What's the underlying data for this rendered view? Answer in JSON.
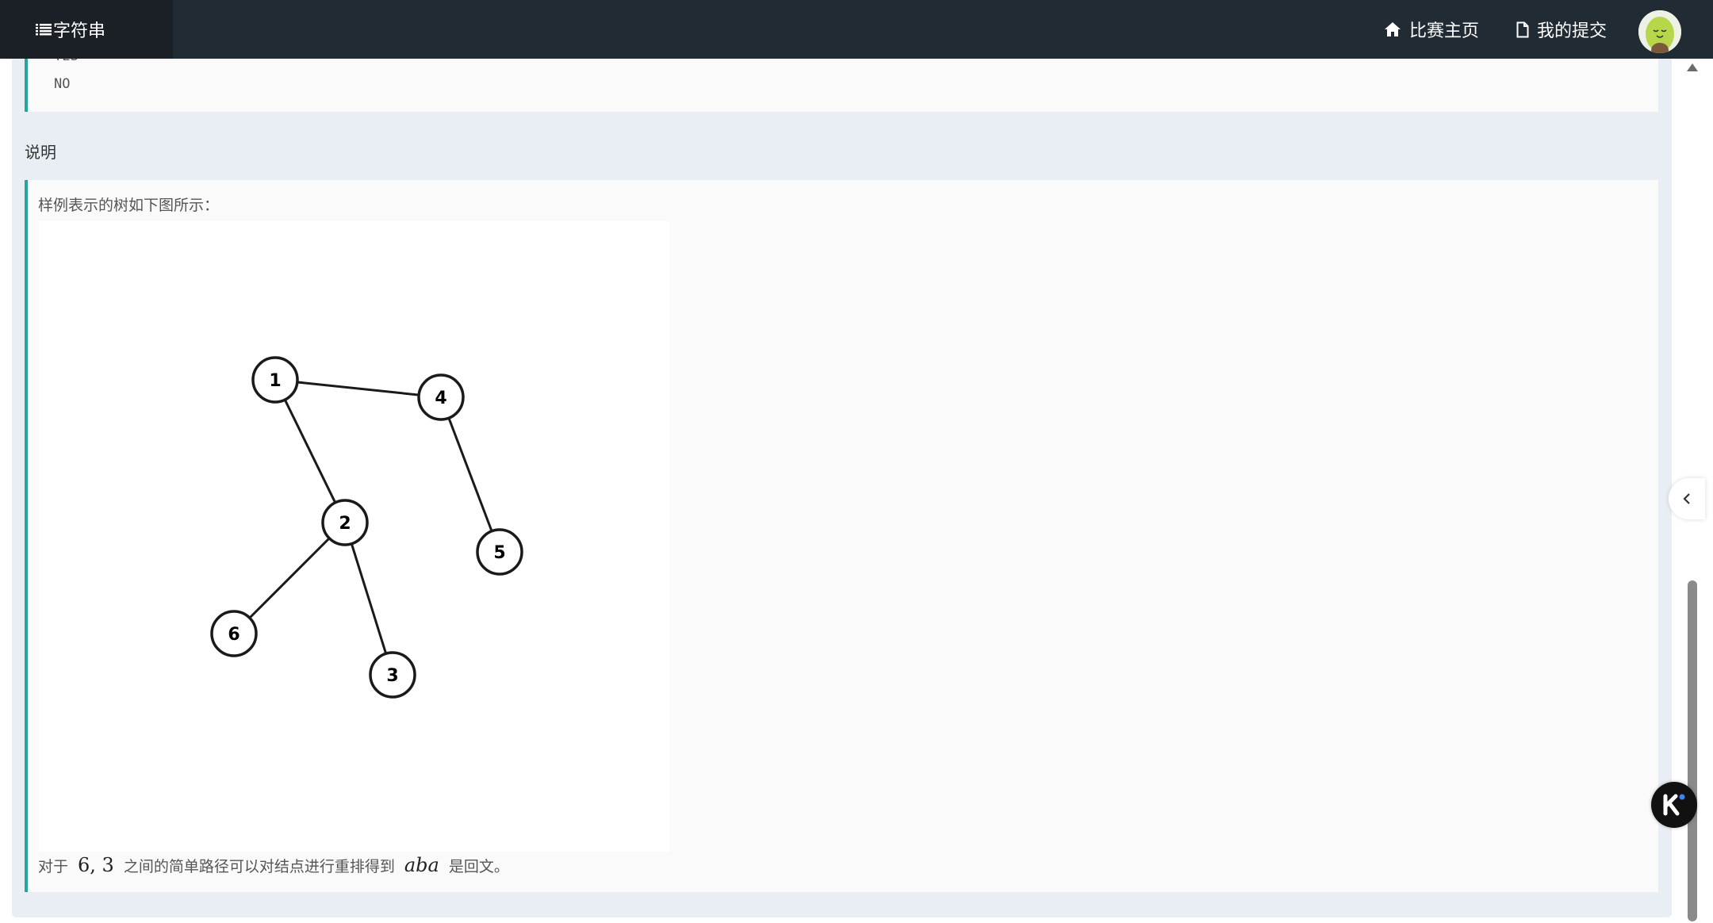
{
  "nav": {
    "brand_title": "字符串",
    "home_label": "比赛主页",
    "submissions_label": "我的提交"
  },
  "sample": {
    "output_cut": "YES",
    "output_text": "NO"
  },
  "section": {
    "title": "说明"
  },
  "description": {
    "intro": "样例表示的树如下图所示：",
    "line_prefix": "对于",
    "math_nodes": "6, 3",
    "line_middle": "之间的简单路径可以对结点进行重排得到",
    "math_word": "aba",
    "line_suffix": "是回文。"
  },
  "tree_figure": {
    "nodes": [
      {
        "label": "1"
      },
      {
        "label": "4"
      },
      {
        "label": "2"
      },
      {
        "label": "5"
      },
      {
        "label": "6"
      },
      {
        "label": "3"
      }
    ],
    "edges": [
      [
        "1",
        "4"
      ],
      [
        "1",
        "2"
      ],
      [
        "4",
        "5"
      ],
      [
        "2",
        "6"
      ],
      [
        "2",
        "3"
      ]
    ]
  },
  "icons": {
    "menu": "list-icon",
    "home": "home-icon",
    "file": "file-icon",
    "collapse": "chevron-left-icon",
    "assistant": "k-logo-icon"
  },
  "colors": {
    "topbar": "#212b33",
    "accent": "#26a69a",
    "panel": "#e9eef4"
  }
}
